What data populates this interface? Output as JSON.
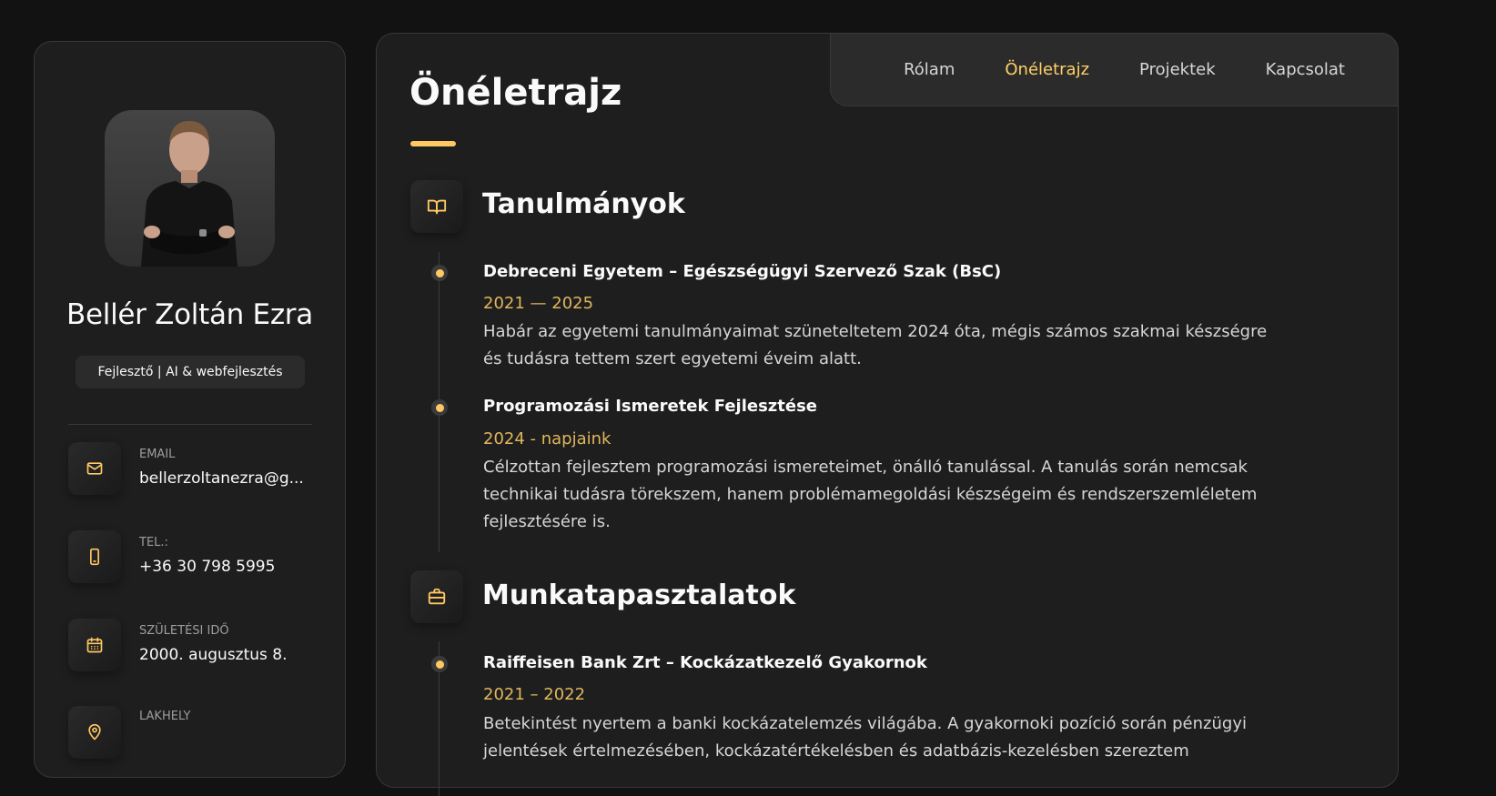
{
  "sidebar": {
    "name": "Bellér Zoltán Ezra",
    "title": "Fejlesztő | AI & webfejlesztés",
    "contacts": [
      {
        "label": "EMAIL",
        "value": "bellerzoltanezra@g...",
        "icon": "mail-icon"
      },
      {
        "label": "TEL.:",
        "value": "+36 30 798 5995",
        "icon": "phone-icon"
      },
      {
        "label": "SZÜLETÉSI IDŐ",
        "value": "2000. augusztus 8.",
        "icon": "calendar-icon"
      },
      {
        "label": "LAKHELY",
        "value": "",
        "icon": "location-icon"
      }
    ]
  },
  "nav": {
    "items": [
      {
        "label": "Rólam",
        "active": false
      },
      {
        "label": "Önéletrajz",
        "active": true
      },
      {
        "label": "Projektek",
        "active": false
      },
      {
        "label": "Kapcsolat",
        "active": false
      }
    ]
  },
  "main": {
    "page_title": "Önéletrajz",
    "education": {
      "title": "Tanulmányok",
      "icon": "book-icon",
      "items": [
        {
          "title": "Debreceni Egyetem – Egészségügyi Szervező Szak (BsC)",
          "date": "2021 — 2025",
          "text": "Habár az egyetemi tanulmányaimat szüneteltetem 2024 óta, mégis számos szakmai készségre és tudásra tettem szert egyetemi éveim alatt."
        },
        {
          "title": "Programozási Ismeretek Fejlesztése",
          "date": "2024 - napjaink",
          "text": "Célzottan fejlesztem programozási ismereteimet, önálló tanulással. A tanulás során nemcsak technikai tudásra törekszem, hanem problémamegoldási készségeim és rendszerszemléletem fejlesztésére is."
        }
      ]
    },
    "experience": {
      "title": "Munkatapasztalatok",
      "icon": "briefcase-icon",
      "items": [
        {
          "title": "Raiffeisen Bank Zrt – Kockázatkezelő Gyakornok",
          "date": "2021 – 2022",
          "text": "Betekintést nyertem a banki kockázatelemzés világába. A gyakornoki pozíció során pénzügyi jelentések értelmezésében, kockázatértékelésben és adatbázis-kezelésben szereztem"
        }
      ]
    }
  },
  "colors": {
    "accent": "#ffc862",
    "accent_text": "#e0b65b",
    "background": "#121212",
    "card": "#1e1e1f"
  }
}
